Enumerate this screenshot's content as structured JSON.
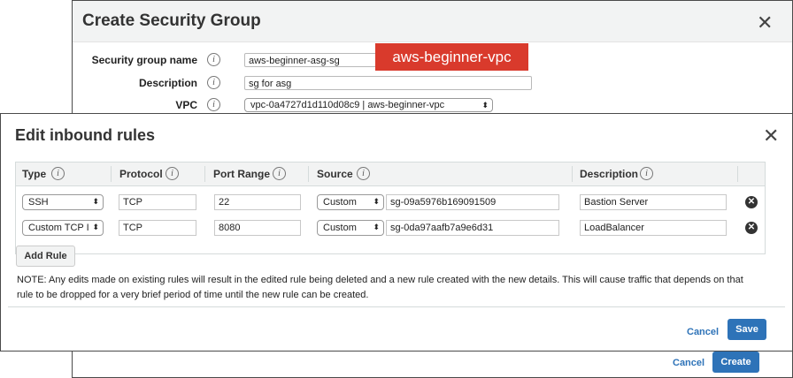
{
  "create_sg": {
    "title": "Create Security Group",
    "close_glyph": "✕",
    "fields": {
      "name_label": "Security group name",
      "name_value": "aws-beginner-asg-sg",
      "description_label": "Description",
      "description_value": "sg for asg",
      "vpc_label": "VPC",
      "vpc_value": "vpc-0a4727d1d110d08c9 | aws-beginner-vpc"
    },
    "info_glyph": "i",
    "cancel_label": "Cancel",
    "create_label": "Create"
  },
  "vpc_banner": "aws-beginner-vpc",
  "edit_inbound": {
    "title": "Edit inbound rules",
    "close_glyph": "✕",
    "columns": {
      "type": "Type",
      "protocol": "Protocol",
      "port_range": "Port Range",
      "source": "Source",
      "description": "Description"
    },
    "rows": [
      {
        "type": "SSH",
        "protocol": "TCP",
        "port_range": "22",
        "source_type": "Custom",
        "source_value": "sg-09a5976b169091509",
        "description": "Bastion Server"
      },
      {
        "type": "Custom TCP I",
        "protocol": "TCP",
        "port_range": "8080",
        "source_type": "Custom",
        "source_value": "sg-0da97aafb7a9e6d31",
        "description": "LoadBalancer"
      }
    ],
    "add_rule_label": "Add Rule",
    "note": "NOTE: Any edits made on existing rules will result in the edited rule being deleted and a new rule created with the new details. This will cause traffic that depends on that rule to be dropped for a very brief period of time until the new rule can be created.",
    "cancel_label": "Cancel",
    "save_label": "Save",
    "remove_glyph": "✕",
    "select_arrows": "⬍"
  },
  "colors": {
    "primary": "#2e73b8",
    "banner": "#d93a2c",
    "header_bg": "#f2f3f3"
  }
}
